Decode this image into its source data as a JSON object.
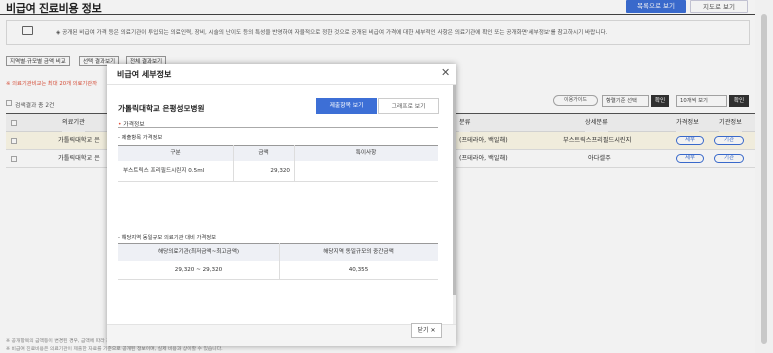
{
  "header": {
    "title": "비급여 진료비용 정보",
    "view_list": "목록으로 보기",
    "view_map": "지도로 보기"
  },
  "notice": {
    "text": "◈ 공개된 비급여 가격 등은 의료기관이 투입되는 의료인력, 장비, 시술의 난이도 등의 특성을 반영하여 자율적으로 정한 것으로 공개된 비급여 가격에 대한 세부적인 사항은 의료기관에 확인 또는 공개화면'세부정보'를 참고하시기 바랍니다."
  },
  "filters": [
    "지역별·규모별 금액 비교",
    "선택 결과보기",
    "전체 결과보기"
  ],
  "red_note": "※ 의료기관비교는 최대 20개 의료기관까",
  "result_count": "검색결과 총 2건",
  "toolbar": {
    "guide": "이용가이드",
    "sort_select": "항렬기준 선택",
    "confirm1": "확인",
    "per_page": "10개씩 보기",
    "confirm2": "확인"
  },
  "table": {
    "headers": [
      "의료기관",
      "분류",
      "상세분류",
      "가격정보",
      "기관정보"
    ],
    "rows": [
      {
        "hospital": "가톨릭대학교 은",
        "category": "(프테라아, 백일해)",
        "detail": "부스트릭스프리필드시린지",
        "price_btn": "세부",
        "inst_btn": "기관"
      },
      {
        "hospital": "가톨릭대학교 은",
        "category": "(프테라아, 백일해)",
        "detail": "아다셀주",
        "price_btn": "세부",
        "inst_btn": "기관"
      }
    ]
  },
  "footer_notes": [
    "※ 공개항목의 금액등이 변경된 경우, 금액에 따라 최대 1개월까지 소요될 수 있으므로, 변경내역이 실시간으로 반영되지 않을 수 있음을 알려드립니다.",
    "※ 비급여 진료비용은 의료기관이 제출한 자료를 기준으로 공개된 정보이며, 실제 비용과 상이할 수 있습니다."
  ],
  "modal": {
    "title": "비급여 세부정보",
    "hospital": "가톨릭대학교 은평성모병원",
    "tab_items": "제출항목 보기",
    "tab_graph": "그래프로 보기",
    "section_label": "가격정보",
    "group1_label": "- 제출항목 가격정보",
    "price_table": {
      "headers": [
        "구분",
        "금액",
        "특이사항"
      ],
      "rows": [
        {
          "name": "부스트릭스 프리필드시린지 0.5ml",
          "amount": "29,320",
          "note": ""
        }
      ]
    },
    "group2_label": "- 해당지역 동일규모 의료기관 대비 가격정보",
    "compare_table": {
      "headers": [
        "해당의료기관(최저금액~최고금액)",
        "해당지역 동일규모의 중간금액"
      ],
      "rows": [
        {
          "range": "29,320 ~ 29,320",
          "median": "40,355"
        }
      ]
    },
    "close_label": "닫기 ✕"
  },
  "colors": {
    "accent": "#3d6fd6",
    "notice_red": "#e0513a"
  }
}
